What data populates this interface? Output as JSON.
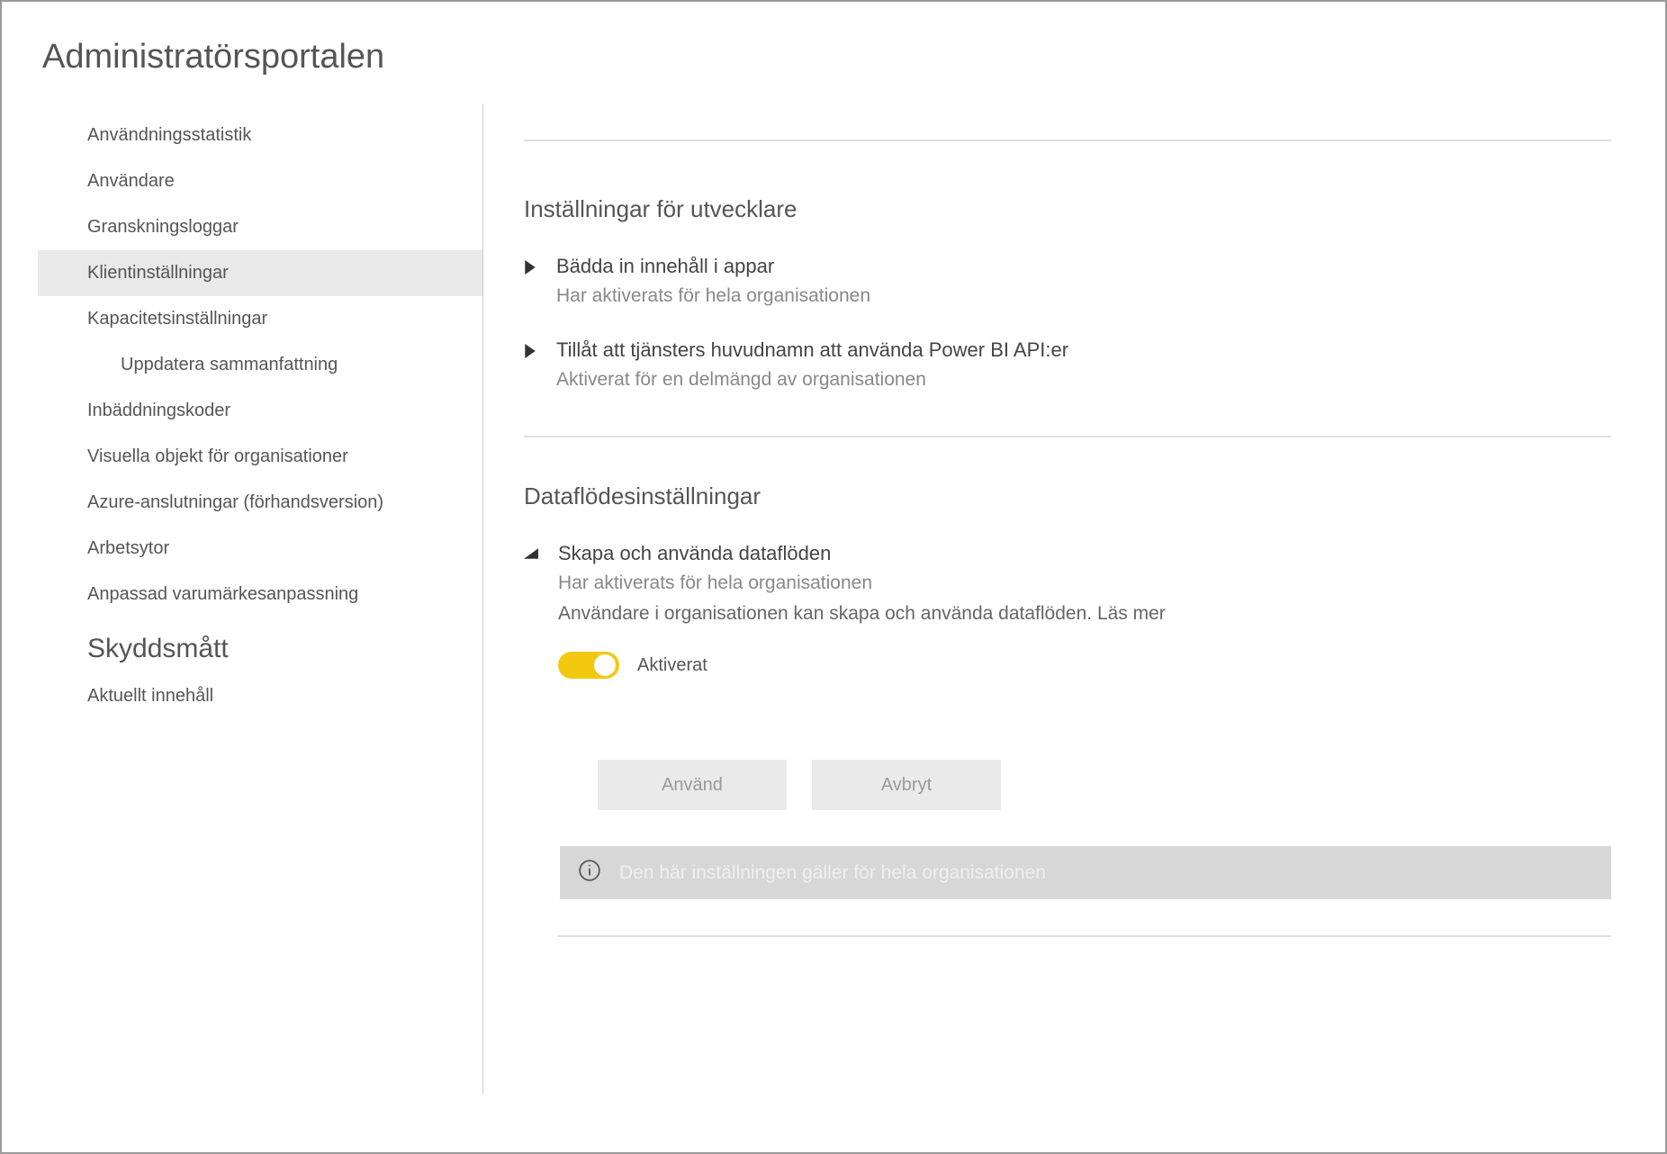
{
  "page_title": "Administratörsportalen",
  "sidebar": {
    "items": [
      {
        "label": "Användningsstatistik",
        "selected": false
      },
      {
        "label": "Användare",
        "selected": false
      },
      {
        "label": "Granskningsloggar",
        "selected": false
      },
      {
        "label": "Klientinställningar",
        "selected": true
      },
      {
        "label": "Kapacitetsinställningar",
        "selected": false
      },
      {
        "label": "Uppdatera sammanfattning",
        "selected": false,
        "sub": true
      },
      {
        "label": "Inbäddningskoder",
        "selected": false
      },
      {
        "label": "Visuella objekt för organisationer",
        "selected": false
      },
      {
        "label": "Azure-anslutningar (förhandsversion)",
        "selected": false
      },
      {
        "label": "Arbetsytor",
        "selected": false
      },
      {
        "label": "Anpassad varumärkesanpassning",
        "selected": false
      },
      {
        "label": "Skyddsmått",
        "selected": false,
        "heading": true
      },
      {
        "label": "Aktuellt innehåll",
        "selected": false
      }
    ]
  },
  "sections": {
    "developer": {
      "heading": "Inställningar för utvecklare",
      "settings": [
        {
          "title": "Bädda in innehåll i appar",
          "subtitle": "Har aktiverats för hela organisationen"
        },
        {
          "title": "Tillåt att tjänsters huvudnamn att använda Power BI API:er",
          "subtitle": "Aktiverat för en delmängd av organisationen"
        }
      ]
    },
    "dataflow": {
      "heading": "Dataflödesinställningar",
      "setting": {
        "title": "Skapa och använda dataflöden",
        "subtitle": "Har aktiverats för hela organisationen",
        "description": "Användare i organisationen kan skapa och använda dataflöden. Läs mer",
        "toggle_label": "Aktiverat",
        "toggle_on": true
      },
      "buttons": {
        "apply": "Använd",
        "cancel": "Avbryt"
      },
      "info_banner": "Den här inställningen gäller för hela organisationen"
    }
  }
}
